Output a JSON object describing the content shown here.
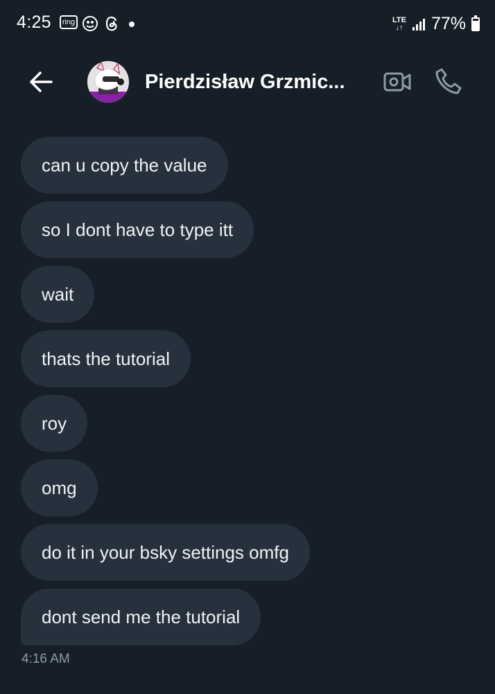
{
  "status_bar": {
    "time": "4:25",
    "notification_icons": [
      "ring-icon",
      "app-icon",
      "threads-icon"
    ],
    "ring_label": "ring",
    "network": "LTE",
    "battery_percent": "77%",
    "battery_level": 0.77
  },
  "header": {
    "contact_name": "Pierdzisław Grzmic..."
  },
  "messages": [
    "can u copy the value",
    "so I dont have to type itt",
    "wait",
    "thats the tutorial",
    "roy",
    "omg",
    "do it in your bsky settings omfg",
    "dont send me the tutorial"
  ],
  "timestamp": "4:16 AM",
  "colors": {
    "background": "#161e27",
    "bubble": "#27313d",
    "muted": "#8e9aa8"
  }
}
